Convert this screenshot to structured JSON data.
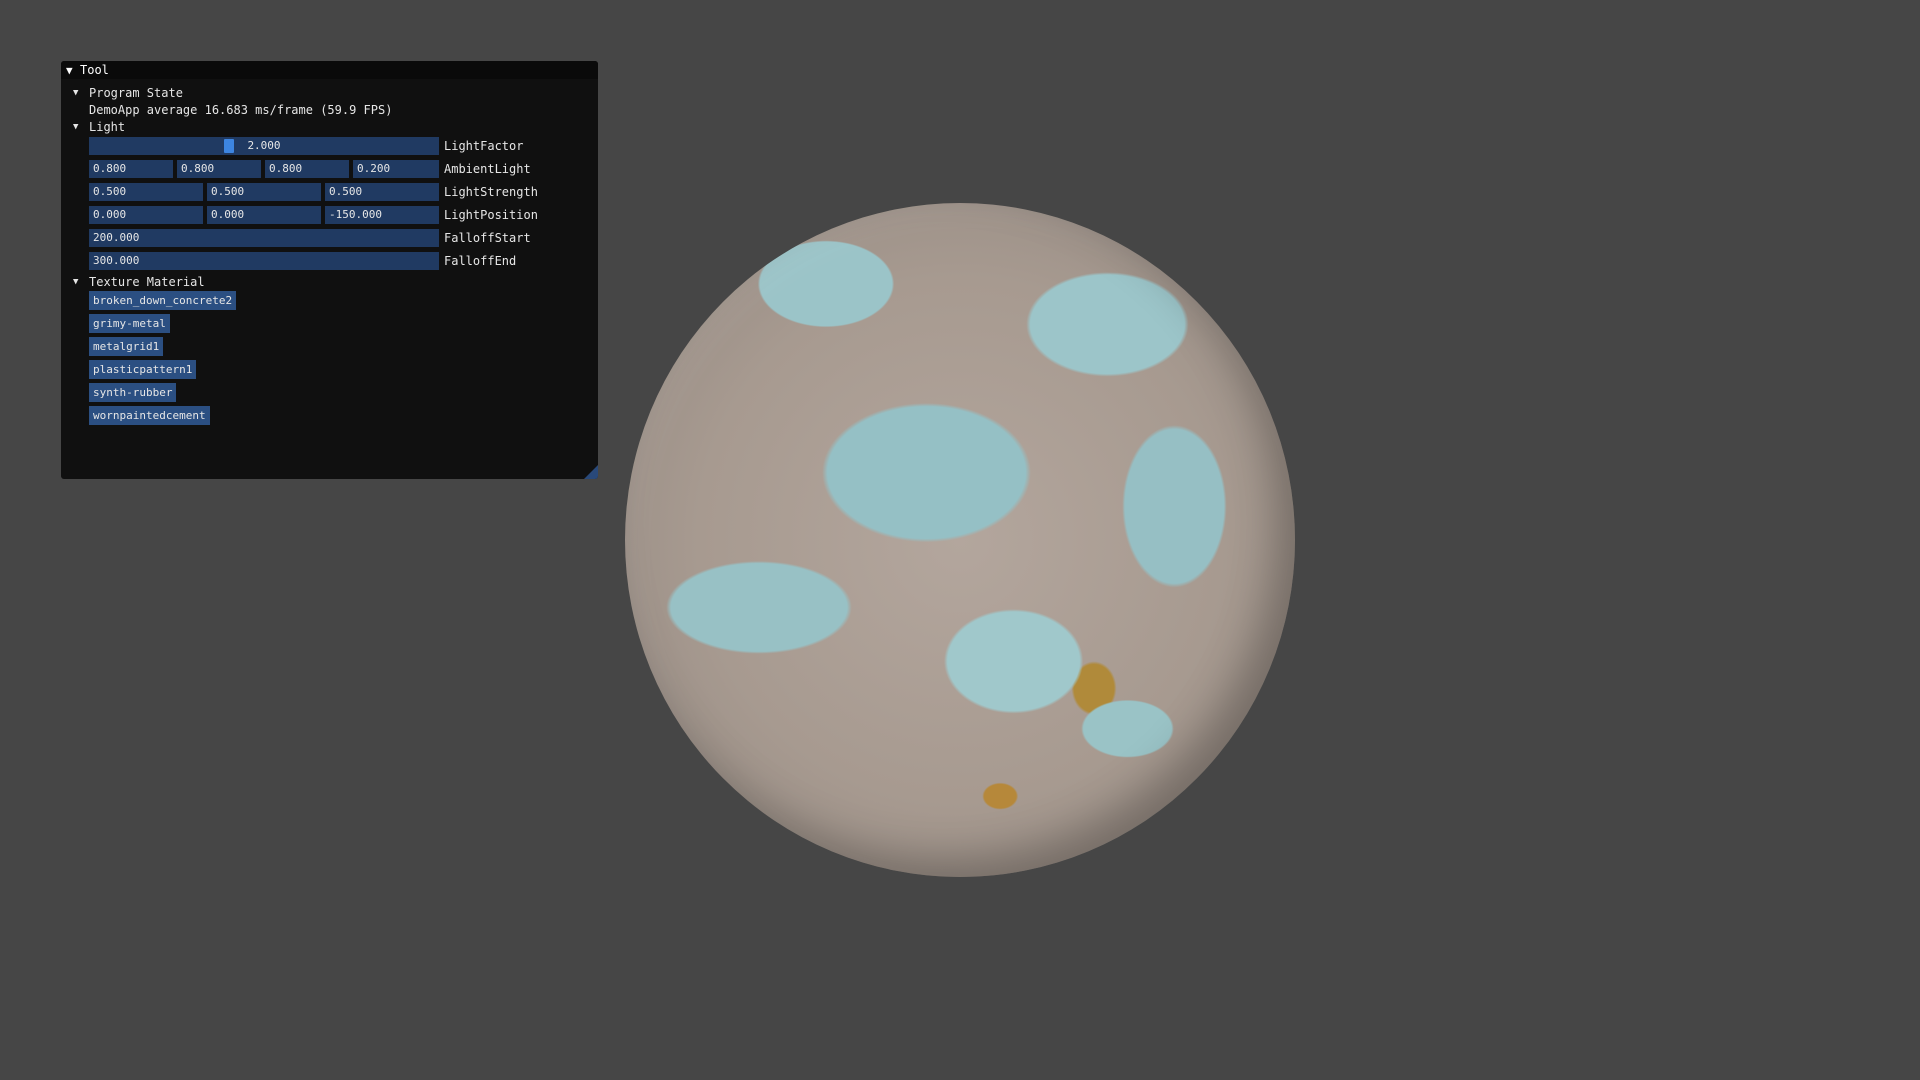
{
  "tool_window": {
    "title": "Tool",
    "collapse_arrow": "triangle-down-icon"
  },
  "program_state": {
    "header": "Program State",
    "fps_text": "DemoApp average 16.683 ms/frame (59.9 FPS)"
  },
  "light": {
    "header": "Light",
    "light_factor": {
      "value": "2.000",
      "label": "LightFactor",
      "min": 0,
      "max": 6,
      "fraction": 0.4
    },
    "ambient_light": {
      "values": [
        "0.800",
        "0.800",
        "0.800",
        "0.200"
      ],
      "label": "AmbientLight"
    },
    "light_strength": {
      "values": [
        "0.500",
        "0.500",
        "0.500"
      ],
      "label": "LightStrength"
    },
    "light_position": {
      "values": [
        "0.000",
        "0.000",
        "-150.000"
      ],
      "label": "LightPosition"
    },
    "falloff_start": {
      "value": "200.000",
      "label": "FalloffStart"
    },
    "falloff_end": {
      "value": "300.000",
      "label": "FalloffEnd"
    }
  },
  "texture_material": {
    "header": "Texture Material",
    "items": [
      "broken_down_concrete2",
      "grimy-metal",
      "metalgrid1",
      "plasticpattern1",
      "synth-rubber",
      "wornpaintedcement"
    ]
  },
  "colors": {
    "background": "#464646",
    "window_bg": "#101010",
    "frame_bg": "#203a62",
    "button_bg": "#2b4f82",
    "slider_grab": "#3d85e0"
  }
}
